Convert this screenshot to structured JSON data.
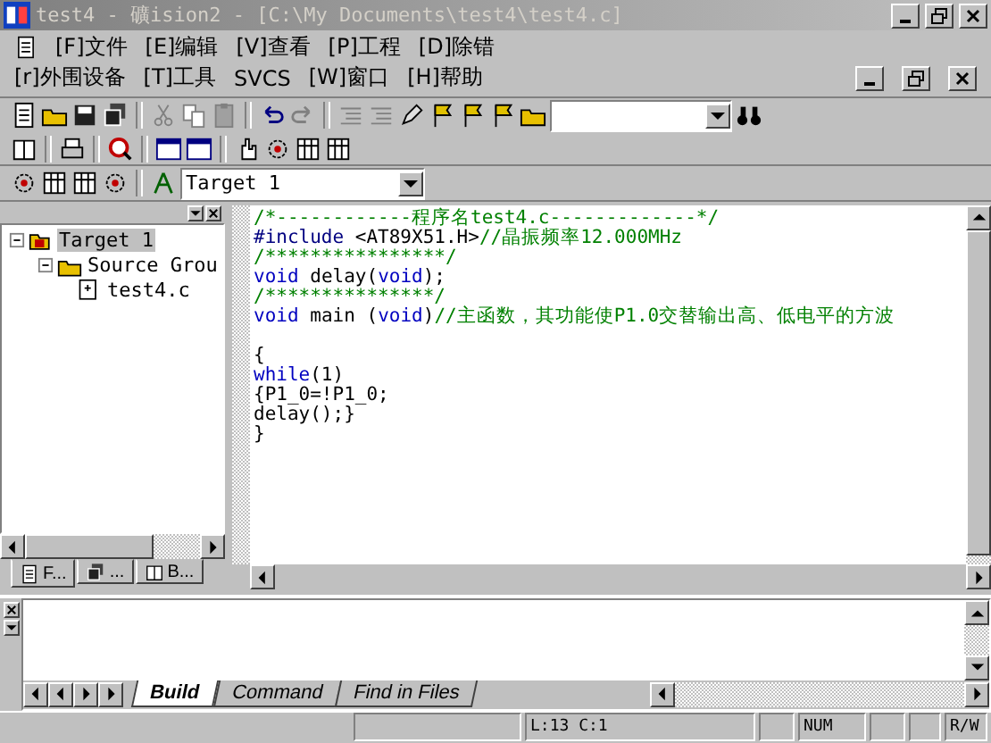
{
  "window": {
    "title": "test4  - 礦ision2 - [C:\\My Documents\\test4\\test4.c]"
  },
  "menu_row_1": [
    "[F]文件",
    "[E]编辑",
    "[V]查看",
    "[P]工程",
    "[D]除错"
  ],
  "menu_row_2": [
    "[r]外围设备",
    "[T]工具",
    "SVCS",
    "[W]窗口",
    "[H]帮助"
  ],
  "target_select": {
    "value": "Target 1"
  },
  "project_tree": [
    {
      "label": "Target 1",
      "selected": true,
      "expanded": true,
      "children": [
        {
          "label": "Source Grou",
          "selected": false,
          "expanded": true,
          "children": [
            {
              "label": "test4.c",
              "selected": false
            }
          ]
        }
      ]
    }
  ],
  "project_tabs": [
    {
      "label": "F...",
      "selected": true
    },
    {
      "label": "...",
      "selected": false
    },
    {
      "label": "B...",
      "selected": false
    }
  ],
  "editor": {
    "lines": [
      {
        "kind": "code",
        "segments": [
          {
            "kind": "comment",
            "text": "/*------------程序名test4.c-------------*/"
          }
        ]
      },
      {
        "kind": "code",
        "segments": [
          {
            "kind": "preproc",
            "text": "#include"
          },
          {
            "kind": "plain",
            "text": " <AT89X51.H>"
          },
          {
            "kind": "comment",
            "text": "//晶振频率12.000MHz"
          }
        ]
      },
      {
        "kind": "code",
        "segments": [
          {
            "kind": "comment",
            "text": "/****************/"
          }
        ]
      },
      {
        "kind": "code",
        "segments": [
          {
            "kind": "keyword",
            "text": "void"
          },
          {
            "kind": "plain",
            "text": " delay("
          },
          {
            "kind": "keyword",
            "text": "void"
          },
          {
            "kind": "plain",
            "text": ");"
          }
        ]
      },
      {
        "kind": "code",
        "segments": [
          {
            "kind": "comment",
            "text": "/***************/"
          }
        ]
      },
      {
        "kind": "code",
        "segments": [
          {
            "kind": "keyword",
            "text": "void"
          },
          {
            "kind": "plain",
            "text": " main ("
          },
          {
            "kind": "keyword",
            "text": "void"
          },
          {
            "kind": "plain",
            "text": ")"
          },
          {
            "kind": "comment",
            "text": "//主函数，其功能使P1.0交替输出高、低电平的方波"
          }
        ]
      },
      {
        "kind": "blank"
      },
      {
        "kind": "code",
        "segments": [
          {
            "kind": "plain",
            "text": "{"
          }
        ]
      },
      {
        "kind": "code",
        "segments": [
          {
            "kind": "keyword",
            "text": "while"
          },
          {
            "kind": "plain",
            "text": "(1)"
          }
        ]
      },
      {
        "kind": "code",
        "segments": [
          {
            "kind": "plain",
            "text": "{P1_0=!P1_0;"
          }
        ]
      },
      {
        "kind": "code",
        "segments": [
          {
            "kind": "plain",
            "text": "delay();}"
          }
        ]
      },
      {
        "kind": "code",
        "segments": [
          {
            "kind": "plain",
            "text": "}"
          }
        ]
      }
    ]
  },
  "output_tabs": [
    {
      "label": "Build",
      "selected": true
    },
    {
      "label": "Command",
      "selected": false
    },
    {
      "label": "Find in Files",
      "selected": false
    }
  ],
  "status_bar": {
    "position": "L:13 C:1",
    "num": "NUM",
    "rw": "R/W"
  }
}
